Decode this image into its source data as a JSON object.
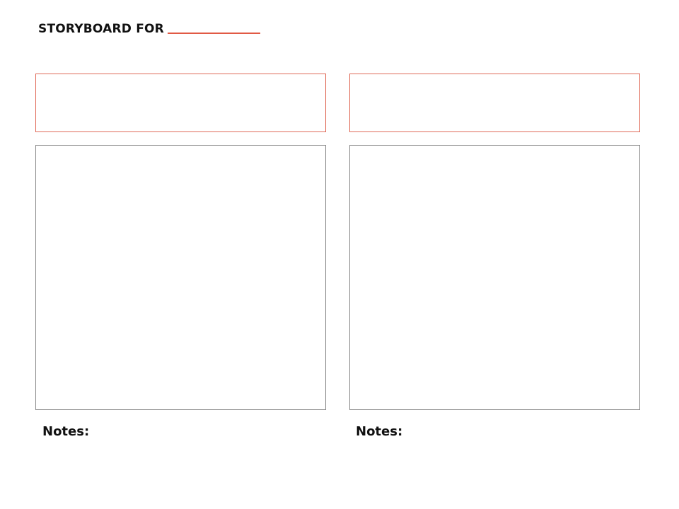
{
  "header": {
    "title": "STORYBOARD FOR"
  },
  "colors": {
    "accent": "#e15a45",
    "frame_border": "#8c8c8c",
    "text": "#111111",
    "background": "#ffffff"
  },
  "panels": [
    {
      "notes_label": "Notes:"
    },
    {
      "notes_label": "Notes:"
    }
  ]
}
